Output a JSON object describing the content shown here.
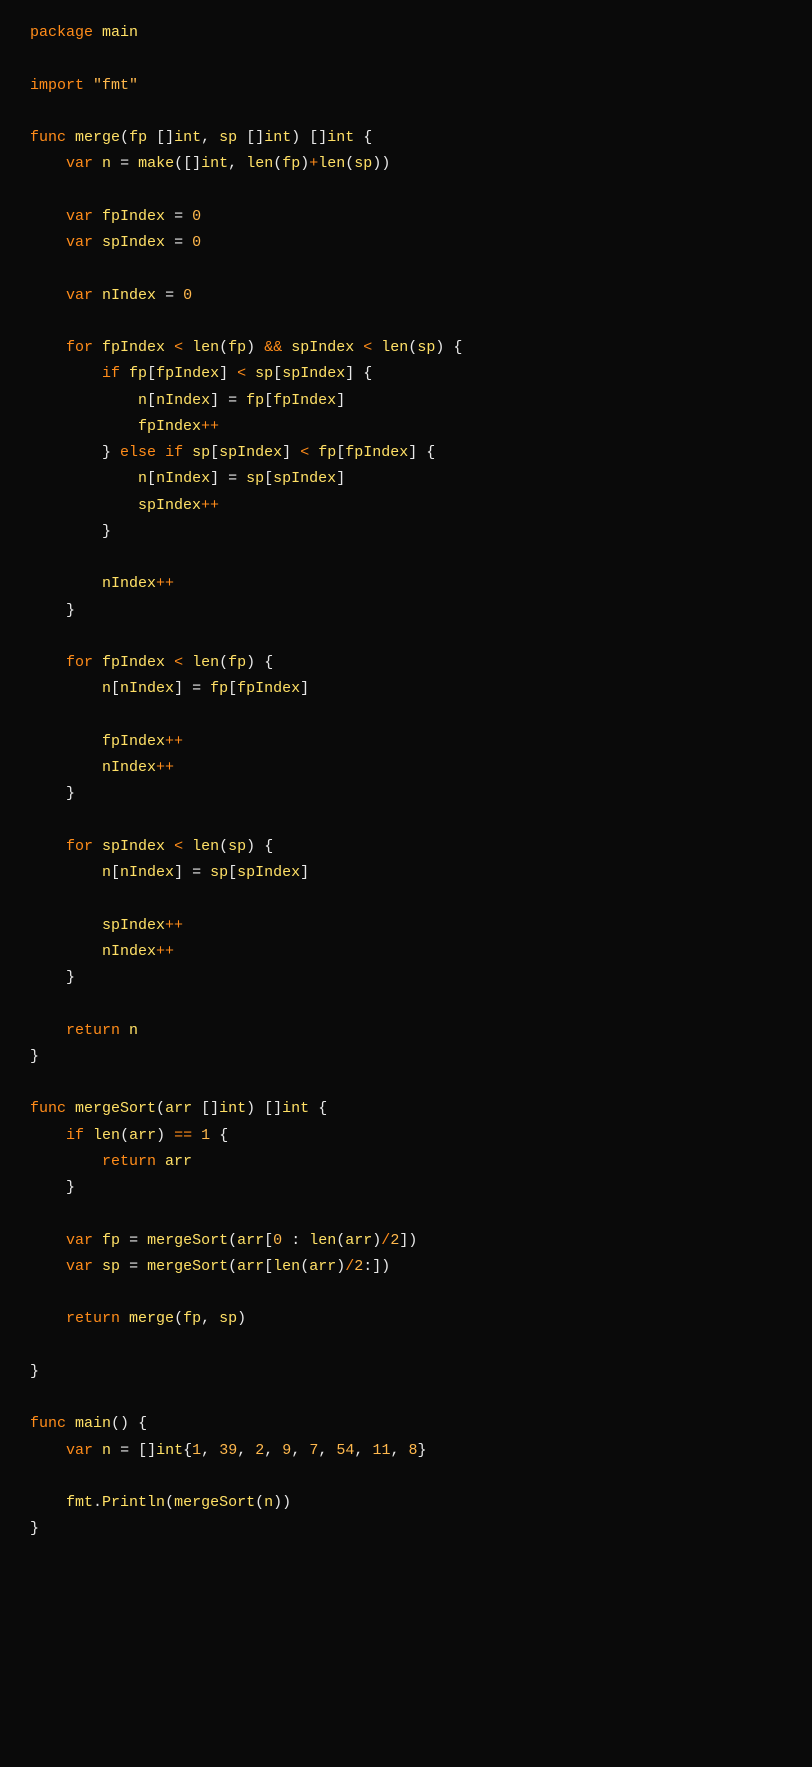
{
  "code": {
    "l1": {
      "kw1": "package",
      "id1": "main"
    },
    "l2": {
      "kw1": "import",
      "str1": "\"fmt\""
    },
    "l3": {
      "kw1": "func",
      "fn1": "merge",
      "id1": "fp",
      "typ1": "int",
      "id2": "sp",
      "typ2": "int",
      "typ3": "int"
    },
    "l4": {
      "kw1": "var",
      "id1": "n",
      "fn1": "make",
      "typ1": "int",
      "fn2": "len",
      "id2": "fp",
      "fn3": "len",
      "id3": "sp"
    },
    "l5": {
      "kw1": "var",
      "id1": "fpIndex",
      "num1": "0"
    },
    "l6": {
      "kw1": "var",
      "id1": "spIndex",
      "num1": "0"
    },
    "l7": {
      "kw1": "var",
      "id1": "nIndex",
      "num1": "0"
    },
    "l8": {
      "kw1": "for",
      "id1": "fpIndex",
      "fn1": "len",
      "id2": "fp",
      "op1": "&&",
      "id3": "spIndex",
      "fn2": "len",
      "id4": "sp"
    },
    "l9": {
      "kw1": "if",
      "id1": "fp",
      "id2": "fpIndex",
      "id3": "sp",
      "id4": "spIndex"
    },
    "l10": {
      "id1": "n",
      "id2": "nIndex",
      "id3": "fp",
      "id4": "fpIndex"
    },
    "l11": {
      "id1": "fpIndex",
      "op1": "++"
    },
    "l12": {
      "kw1": "else",
      "kw2": "if",
      "id1": "sp",
      "id2": "spIndex",
      "id3": "fp",
      "id4": "fpIndex"
    },
    "l13": {
      "id1": "n",
      "id2": "nIndex",
      "id3": "sp",
      "id4": "spIndex"
    },
    "l14": {
      "id1": "spIndex",
      "op1": "++"
    },
    "l15": {
      "id1": "nIndex",
      "op1": "++"
    },
    "l16": {
      "kw1": "for",
      "id1": "fpIndex",
      "fn1": "len",
      "id2": "fp"
    },
    "l17": {
      "id1": "n",
      "id2": "nIndex",
      "id3": "fp",
      "id4": "fpIndex"
    },
    "l18": {
      "id1": "fpIndex",
      "op1": "++"
    },
    "l19": {
      "id1": "nIndex",
      "op1": "++"
    },
    "l20": {
      "kw1": "for",
      "id1": "spIndex",
      "fn1": "len",
      "id2": "sp"
    },
    "l21": {
      "id1": "n",
      "id2": "nIndex",
      "id3": "sp",
      "id4": "spIndex"
    },
    "l22": {
      "id1": "spIndex",
      "op1": "++"
    },
    "l23": {
      "id1": "nIndex",
      "op1": "++"
    },
    "l24": {
      "kw1": "return",
      "id1": "n"
    },
    "l25": {
      "kw1": "func",
      "fn1": "mergeSort",
      "id1": "arr",
      "typ1": "int",
      "typ2": "int"
    },
    "l26": {
      "kw1": "if",
      "fn1": "len",
      "id1": "arr",
      "op1": "==",
      "num1": "1"
    },
    "l27": {
      "kw1": "return",
      "id1": "arr"
    },
    "l28": {
      "kw1": "var",
      "id1": "fp",
      "fn1": "mergeSort",
      "id2": "arr",
      "num1": "0",
      "fn2": "len",
      "id3": "arr",
      "num2": "2"
    },
    "l29": {
      "kw1": "var",
      "id1": "sp",
      "fn1": "mergeSort",
      "id2": "arr",
      "fn2": "len",
      "id3": "arr",
      "num1": "2"
    },
    "l30": {
      "kw1": "return",
      "fn1": "merge",
      "id1": "fp",
      "id2": "sp"
    },
    "l31": {
      "kw1": "func",
      "fn1": "main"
    },
    "l32": {
      "kw1": "var",
      "id1": "n",
      "typ1": "int",
      "n1": "1",
      "n2": "39",
      "n3": "2",
      "n4": "9",
      "n5": "7",
      "n6": "54",
      "n7": "11",
      "n8": "8"
    },
    "l33": {
      "id1": "fmt",
      "fn1": "Println",
      "fn2": "mergeSort",
      "id2": "n"
    }
  }
}
